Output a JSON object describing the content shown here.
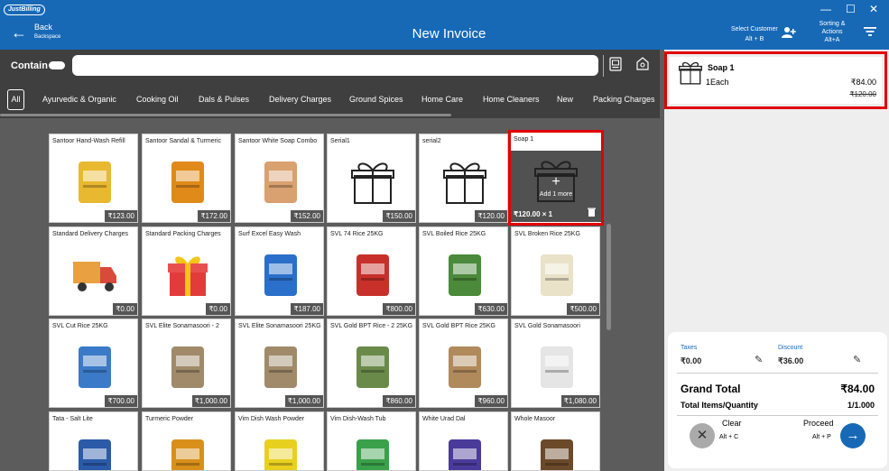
{
  "window": {
    "logo": "JustBilling",
    "controls": [
      "—",
      "☐",
      "✕"
    ]
  },
  "header": {
    "back_label": "Back",
    "back_hint": "Backspace",
    "title": "New Invoice",
    "select_customer": "Select Customer",
    "select_customer_hint": "Alt + B",
    "sorting_line1": "Sorting &",
    "sorting_line2": "Actions",
    "sorting_hint": "Alt+A"
  },
  "search": {
    "contain_label": "Contain",
    "placeholder": ""
  },
  "categories": {
    "all": "All",
    "items": [
      "Ayurvedic & Organic",
      "Cooking Oil",
      "Dals & Pulses",
      "Delivery Charges",
      "Ground Spices",
      "Home Care",
      "Home Cleaners",
      "New",
      "Packing Charges"
    ]
  },
  "products": [
    {
      "name": "Santoor Hand-Wash Refill",
      "price": "₹123.00",
      "icon": "handwash"
    },
    {
      "name": "Santoor Sandal & Turmeric",
      "price": "₹172.00",
      "icon": "soap-box"
    },
    {
      "name": "Santoor White Soap Combo",
      "price": "₹152.00",
      "icon": "soap-pack"
    },
    {
      "name": "Serial1",
      "price": "₹150.00",
      "icon": "gift"
    },
    {
      "name": "serial2",
      "price": "₹120.00",
      "icon": "gift"
    },
    {
      "name": "Soap 1",
      "price": "₹120.00 × 1",
      "icon": "gift"
    },
    {
      "name": "Standard Delivery Charges",
      "price": "₹0.00",
      "icon": "truck"
    },
    {
      "name": "Standard Packing Charges",
      "price": "₹0.00",
      "icon": "gift-red"
    },
    {
      "name": "Surf Excel Easy Wash",
      "price": "₹187.00",
      "icon": "detergent"
    },
    {
      "name": "SVL 74 Rice 25KG",
      "price": "₹800.00",
      "icon": "rice-bag-red"
    },
    {
      "name": "SVL Boiled Rice 25KG",
      "price": "₹630.00",
      "icon": "rice-bag-green"
    },
    {
      "name": "SVL Broken Rice 25KG",
      "price": "₹500.00",
      "icon": "rice-bag-white"
    },
    {
      "name": "SVL Cut Rice 25KG",
      "price": "₹700.00",
      "icon": "rice-bag-blue"
    },
    {
      "name": "SVL Elite Sonamasoori - 2",
      "price": "₹1,000.00",
      "icon": "rice-sack"
    },
    {
      "name": "SVL Elite Sonamasoori 25KG",
      "price": "₹1,000.00",
      "icon": "rice-sack"
    },
    {
      "name": "SVL Gold BPT Rice - 2 25KG",
      "price": "₹860.00",
      "icon": "rice-sack-green"
    },
    {
      "name": "SVL Gold BPT Rice 25KG",
      "price": "₹960.00",
      "icon": "rice-sack-ss"
    },
    {
      "name": "SVL Gold Sonamasoori",
      "price": "₹1,080.00",
      "icon": "rice-sack-white"
    },
    {
      "name": "Tata - Salt Lite",
      "price": "",
      "icon": "salt"
    },
    {
      "name": "Turmeric Powder",
      "price": "",
      "icon": "turmeric"
    },
    {
      "name": "Vim Dish Wash Powder",
      "price": "",
      "icon": "vim"
    },
    {
      "name": "Vim Dish-Wash Tub",
      "price": "",
      "icon": "vim-tub"
    },
    {
      "name": "White Urad Dal",
      "price": "",
      "icon": "urad-dal"
    },
    {
      "name": "Whole Masoor",
      "price": "",
      "icon": "masoor"
    }
  ],
  "selected_tile": {
    "add_more": "Add 1 more"
  },
  "cart": {
    "item": {
      "name": "Soap 1",
      "unit": "1Each",
      "price": "₹84.00",
      "mrp": "₹120.00"
    },
    "taxes_label": "Taxes",
    "taxes_value": "₹0.00",
    "discount_label": "Discount",
    "discount_value": "₹36.00",
    "grand_total_label": "Grand Total",
    "grand_total_value": "₹84.00",
    "total_items_label": "Total Items/Quantity",
    "total_items_value": "1/1.000",
    "clear_label": "Clear",
    "clear_hint": "Alt + C",
    "proceed_label": "Proceed",
    "proceed_hint": "Alt + P"
  },
  "colors": {
    "primary": "#1769b6",
    "highlight": "#e00000",
    "dark_bg": "#3f3f3f"
  }
}
